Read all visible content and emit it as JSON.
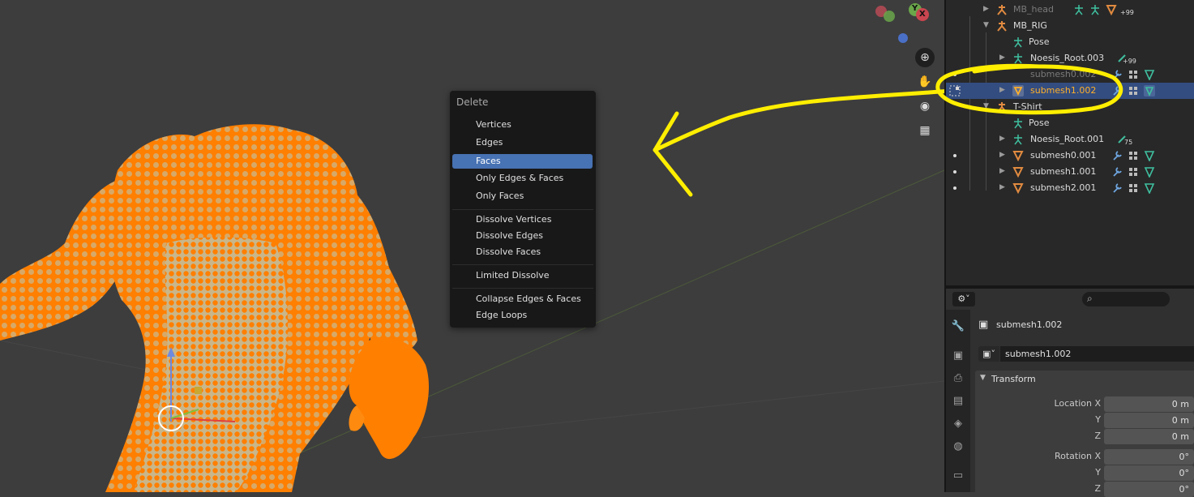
{
  "gizmo": {
    "y_label": "Y",
    "x_label": "X"
  },
  "delete_menu": {
    "title": "Delete",
    "items": [
      "Vertices",
      "Edges",
      "Faces",
      "Only Edges & Faces",
      "Only Faces",
      "Dissolve Vertices",
      "Dissolve Edges",
      "Dissolve Faces",
      "Limited Dissolve",
      "Collapse Edges & Faces",
      "Edge Loops"
    ],
    "active_item": "Faces"
  },
  "outliner": {
    "rows": [
      {
        "label": "MB_head",
        "badge": "+99"
      },
      {
        "label": "MB_RIG"
      },
      {
        "label": "Pose"
      },
      {
        "label": "Noesis_Root.003",
        "badge": "+99"
      },
      {
        "label": "submesh0.002"
      },
      {
        "label": "submesh1.002"
      },
      {
        "label": "T-Shirt"
      },
      {
        "label": "Pose"
      },
      {
        "label": "Noesis_Root.001",
        "badge": "75"
      },
      {
        "label": "submesh0.001"
      },
      {
        "label": "submesh1.001"
      },
      {
        "label": "submesh2.001"
      }
    ],
    "selected": "submesh1.002"
  },
  "properties": {
    "object_name": "submesh1.002",
    "name_field": "submesh1.002",
    "panel_title": "Transform",
    "location": {
      "label": "Location X",
      "y_label": "Y",
      "z_label": "Z",
      "x": "0 m",
      "y": "0 m",
      "z": "0 m"
    },
    "rotation": {
      "label": "Rotation X",
      "y_label": "Y",
      "z_label": "Z",
      "x": "0°",
      "y": "0°",
      "z": "0°"
    }
  },
  "colors": {
    "accent": "#4772b3",
    "selected_text": "#ffaf29",
    "mesh": "#ff7f00",
    "annotation": "#ffee00"
  }
}
